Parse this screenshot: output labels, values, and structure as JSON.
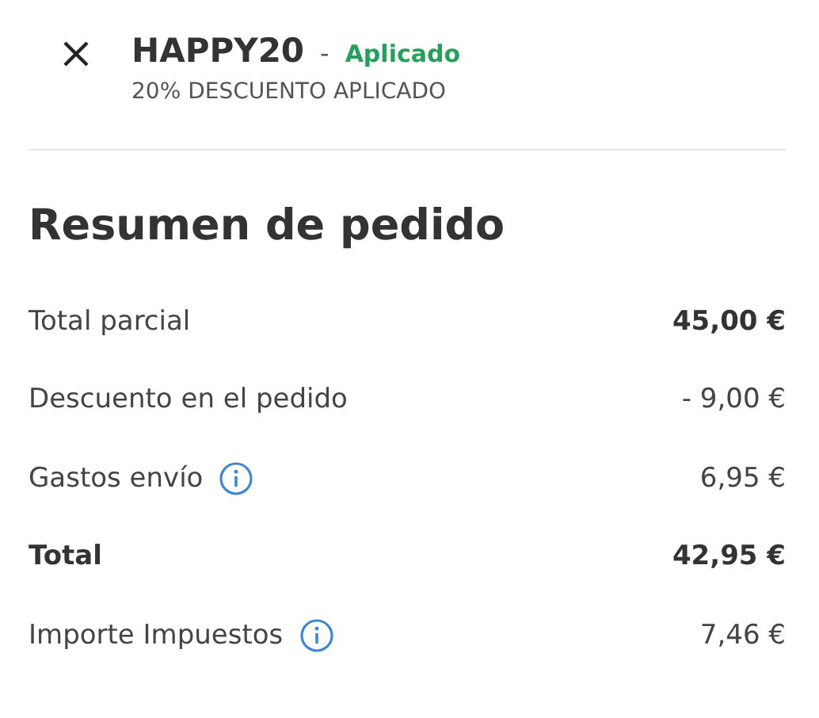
{
  "coupon": {
    "code": "HAPPY20",
    "separator": "-",
    "status": "Aplicado",
    "description": "20% DESCUENTO APLICADO"
  },
  "summary": {
    "title": "Resumen de pedido",
    "rows": [
      {
        "kind": "subtotal",
        "label": "Total parcial",
        "value": "45,00 €",
        "info": false
      },
      {
        "kind": "line",
        "label": "Descuento en el pedido",
        "value": "- 9,00 €",
        "info": false
      },
      {
        "kind": "line",
        "label": "Gastos envío",
        "value": "6,95 €",
        "info": true
      },
      {
        "kind": "total",
        "label": "Total",
        "value": "42,95 €",
        "info": false
      },
      {
        "kind": "line",
        "label": "Importe Impuestos",
        "value": "7,46 €",
        "info": true
      }
    ]
  }
}
